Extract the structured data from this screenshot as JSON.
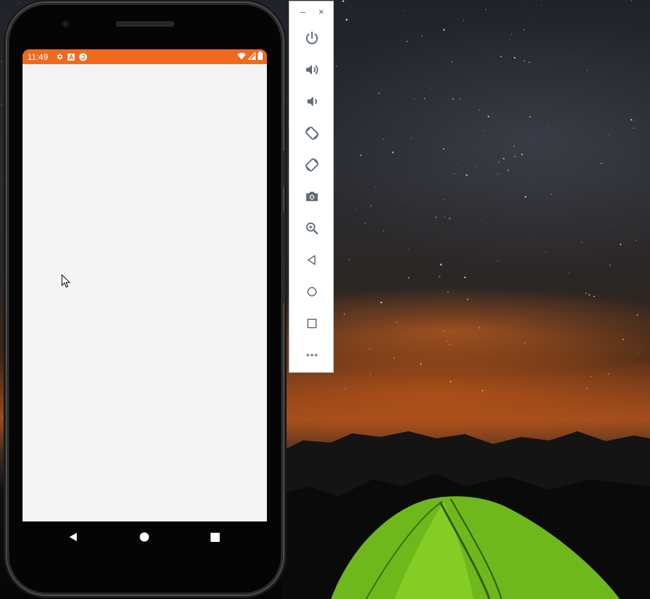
{
  "theme": {
    "status_bar_color": "#EF6A1F",
    "screen_background": "#F4F4F4",
    "toolbar_icon_color": "#5F6B78"
  },
  "status_bar": {
    "time": "11:49",
    "left_icons": [
      "gear-icon",
      "a-letter-icon",
      "sync-circle-icon"
    ],
    "right_icons": [
      "wifi-icon",
      "cell-signal-icon",
      "battery-icon"
    ]
  },
  "nav_bar": {
    "buttons": [
      "back-triangle-icon",
      "home-circle-icon",
      "overview-square-icon"
    ]
  },
  "emulator_toolbar": {
    "window_controls": {
      "minimize": "–",
      "close": "×"
    },
    "buttons": [
      "power-icon",
      "volume-up-icon",
      "volume-down-icon",
      "rotate-left-icon",
      "rotate-right-icon",
      "camera-icon",
      "zoom-icon",
      "back-icon",
      "home-icon",
      "overview-icon",
      "more-icon"
    ]
  }
}
